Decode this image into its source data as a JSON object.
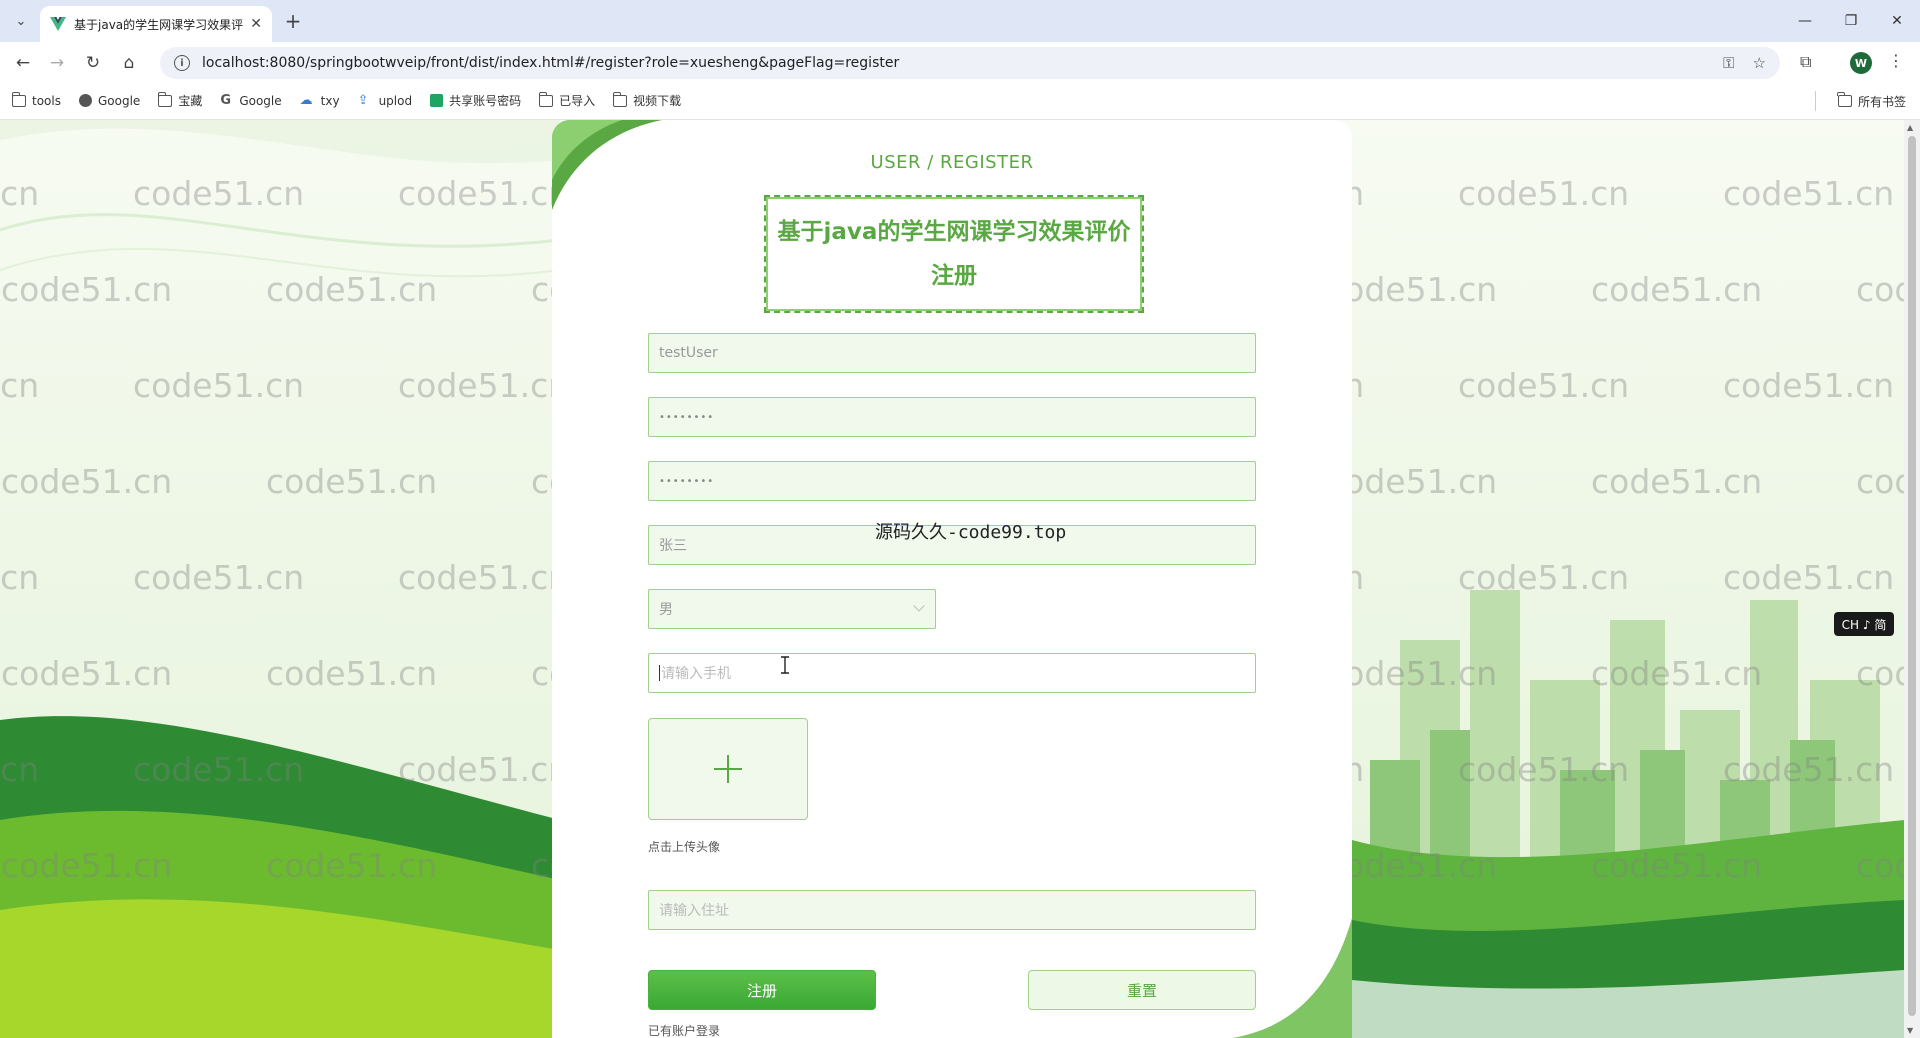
{
  "browser": {
    "tab_title": "基于java的学生网课学习效果评",
    "url": "localhost:8080/springbootwveip/front/dist/index.html#/register?role=xuesheng&pageFlag=register",
    "bookmarks": [
      {
        "label": "tools",
        "icon": "folder-icon"
      },
      {
        "label": "Google",
        "icon": "globe-icon"
      },
      {
        "label": "宝藏",
        "icon": "folder-icon"
      },
      {
        "label": "Google",
        "icon": "google-icon"
      },
      {
        "label": "txy",
        "icon": "cloud-icon"
      },
      {
        "label": "uplod",
        "icon": "upload-icon"
      },
      {
        "label": "共享账号密码",
        "icon": "sheets-icon"
      },
      {
        "label": "已导入",
        "icon": "folder-icon"
      },
      {
        "label": "视频下载",
        "icon": "folder-icon"
      }
    ],
    "all_bookmarks": "所有书签",
    "profile_initial": "W"
  },
  "watermark": "code51.cn",
  "form": {
    "subtitle": "USER / REGISTER",
    "title": "基于java的学生网课学习效果评价注册",
    "account_value": "testUser",
    "password_value": "••••••••",
    "confirm_password_value": "••••••••",
    "name_value": "张三",
    "gender_value": "男",
    "phone_placeholder": "请输入手机",
    "upload_hint": "点击上传头像",
    "address_placeholder": "请输入住址",
    "register_label": "注册",
    "reset_label": "重置",
    "login_link": "已有账户登录"
  },
  "overlay": {
    "site_text": "源码久久-code99.top",
    "ime_label": "CH ♪ 简"
  },
  "colors": {
    "accent": "#5aa843",
    "field_border": "#9fd18b",
    "button_green": "#3aa835"
  }
}
